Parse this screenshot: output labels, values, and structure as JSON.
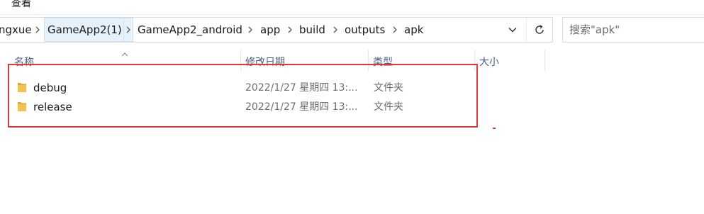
{
  "menu": {
    "view_label": "查看"
  },
  "address_bar": {
    "crumbs": [
      {
        "label": "ngxue"
      },
      {
        "label": "GameApp2(1)"
      },
      {
        "label": "GameApp2_android"
      },
      {
        "label": "app"
      },
      {
        "label": "build"
      },
      {
        "label": "outputs"
      },
      {
        "label": "apk"
      }
    ],
    "dropdown_icon": "chevron-down-icon",
    "refresh_icon": "refresh-icon"
  },
  "search": {
    "placeholder": "搜索\"apk\"",
    "value": ""
  },
  "columns": {
    "name": "名称",
    "modified": "修改日期",
    "type": "类型",
    "size": "大小",
    "sort": "ascending"
  },
  "files": [
    {
      "name": "debug",
      "modified": "2022/1/27 星期四 13:...",
      "type": "文件夹",
      "icon": "folder-icon"
    },
    {
      "name": "release",
      "modified": "2022/1/27 星期四 13:...",
      "type": "文件夹",
      "icon": "folder-icon"
    }
  ],
  "colors": {
    "annotation_red": "#d83b3b",
    "folder_yellow": "#f1c24e",
    "hover_blue": "#e5f1fb",
    "header_text": "#4d6082"
  }
}
